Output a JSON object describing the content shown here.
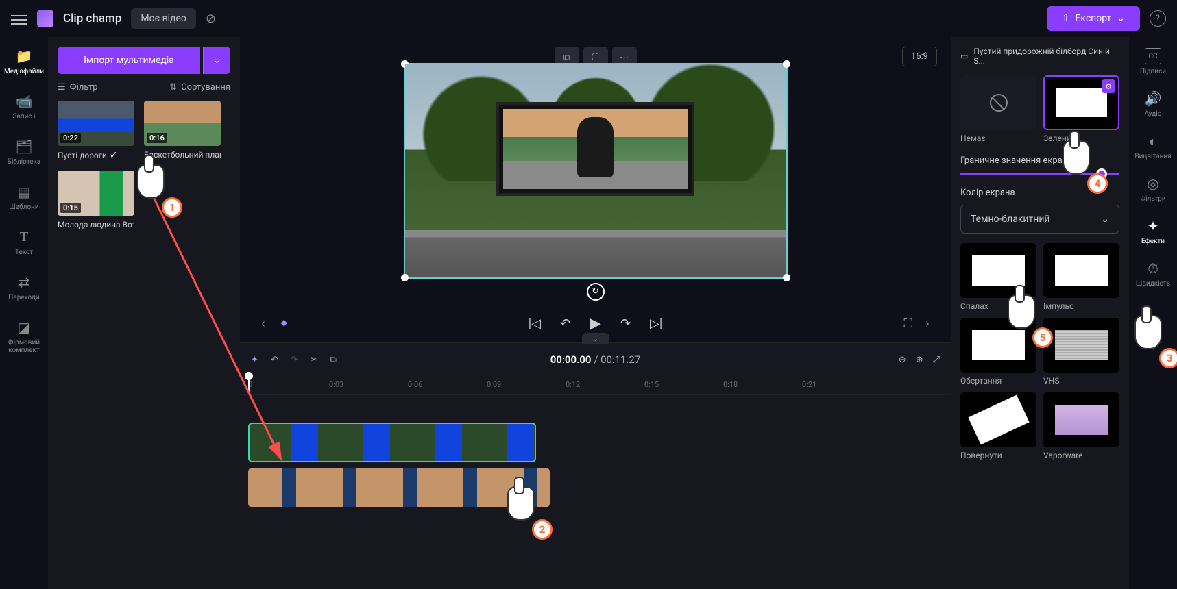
{
  "header": {
    "brand": "Clip champ",
    "project_name": "Моє відео",
    "export_label": "Експорт"
  },
  "left_nav": [
    {
      "label": "Медіафайли",
      "icon": "📁"
    },
    {
      "label": "Запис і",
      "icon": "📹"
    },
    {
      "label": "Бібліотека",
      "icon": "🗂"
    },
    {
      "label": "Шаблони",
      "icon": "▦"
    },
    {
      "label": "Текст",
      "icon": "T"
    },
    {
      "label": "Переходи",
      "icon": "⇄"
    },
    {
      "label": "Фірмовий комплект",
      "icon": "◪"
    }
  ],
  "media_panel": {
    "import_label": "Імпорт мультимедіа",
    "filter_label": "Фільтр",
    "sort_label": "Сортування",
    "items": [
      {
        "name": "Пусті дороги",
        "duration": "0:22",
        "used": true
      },
      {
        "name": "Баскетбольний план V",
        "duration": "0:16",
        "used": true
      },
      {
        "name": "Молода людина Вот",
        "duration": "0:15",
        "used": false
      }
    ]
  },
  "preview": {
    "aspect": "16:9"
  },
  "timeline": {
    "current": "00:00.00",
    "total": "00:11.27",
    "ticks": [
      "0",
      "0:03",
      "0:06",
      "0:09",
      "0:12",
      "0:15",
      "0:18",
      "0:21"
    ]
  },
  "right_panel": {
    "selected_title": "Пустий придорожній білборд Синій S...",
    "none_label": "Немає",
    "green_label": "Зелений",
    "threshold_label": "Граничне значення екрана",
    "screen_color_label": "Колір екрана",
    "screen_color_value": "Темно-блакитний",
    "fx": [
      {
        "label": "Спалах"
      },
      {
        "label": "Імпульс"
      },
      {
        "label": "Обертання"
      },
      {
        "label": "VHS"
      },
      {
        "label": "Повернути"
      },
      {
        "label": "Vaporware"
      }
    ]
  },
  "right_rail": [
    {
      "label": "Підписи",
      "icon": "CC"
    },
    {
      "label": "Аудіо",
      "icon": "🔊"
    },
    {
      "label": "Вицвітання",
      "icon": "◐"
    },
    {
      "label": "Фільтри",
      "icon": "◎"
    },
    {
      "label": "Ефекти",
      "icon": "✦"
    },
    {
      "label": "Швидкість",
      "icon": "⏱"
    }
  ],
  "callouts": {
    "1": "1",
    "2": "2",
    "3": "3",
    "4": "4",
    "5": "5"
  }
}
